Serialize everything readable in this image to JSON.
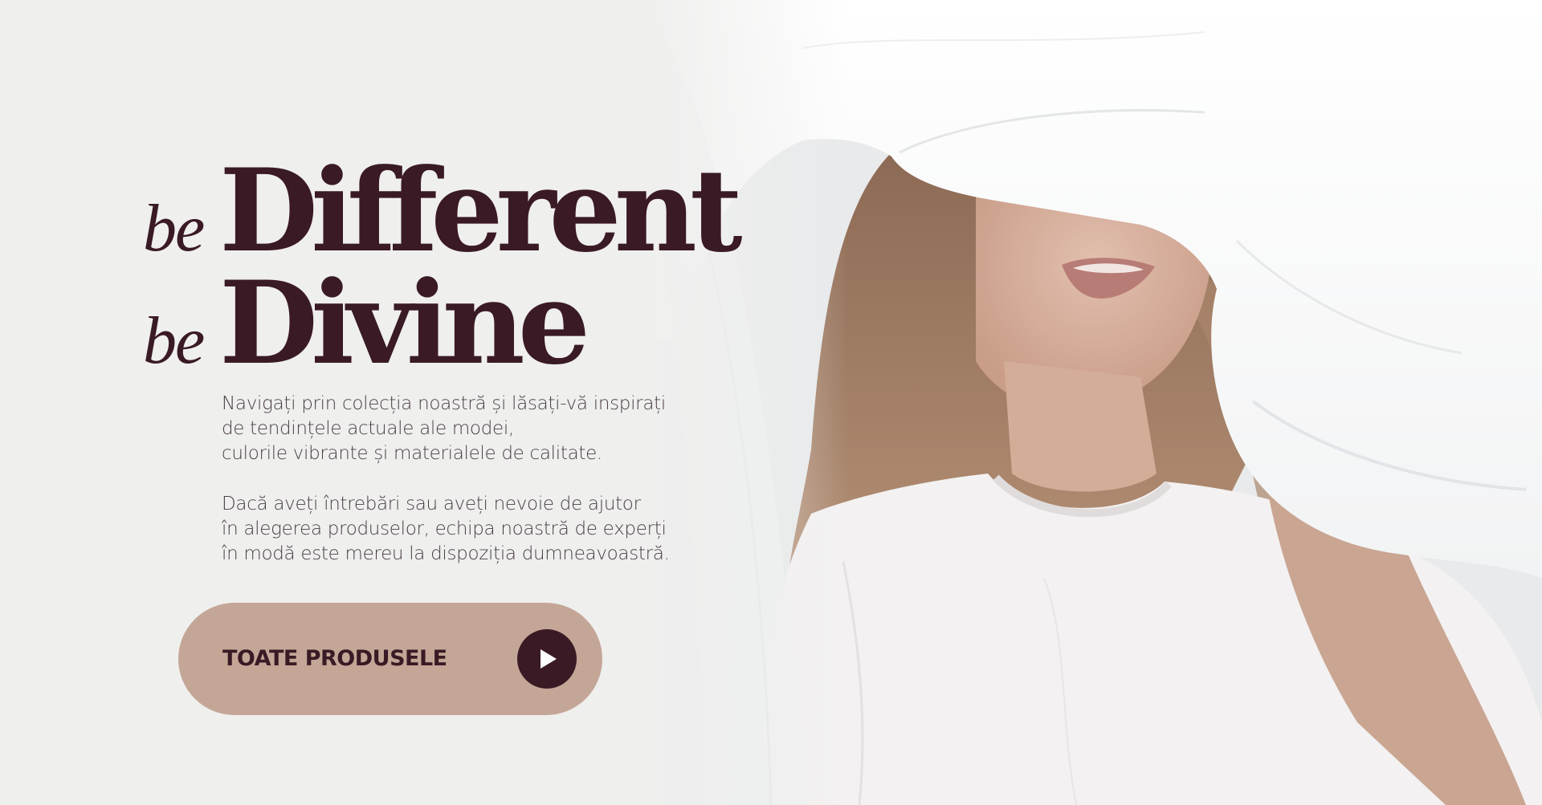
{
  "hero": {
    "headline": {
      "line1_prefix": "be",
      "line1_word": "Different",
      "line2_prefix": "be",
      "line2_word": "Divine"
    },
    "description_1": [
      "Navigați prin colecția noastră și lăsați-vă inspirați",
      "de tendințele actuale ale modei,",
      "culorile vibrante și materialele de calitate."
    ],
    "description_2": [
      "Dacă aveți întrebări sau aveți nevoie de ajutor",
      "în alegerea produselor, echipa noastră de experți",
      "în modă este mereu la dispoziția dumneavoastră."
    ],
    "cta": {
      "label": "TOATE PRODUSELE",
      "icon": "play-icon"
    }
  },
  "colors": {
    "brand_dark": "#3a1a24",
    "cta_background": "#c4a697",
    "body_text": "#4a3f44",
    "page_background": "#eeeeed"
  }
}
